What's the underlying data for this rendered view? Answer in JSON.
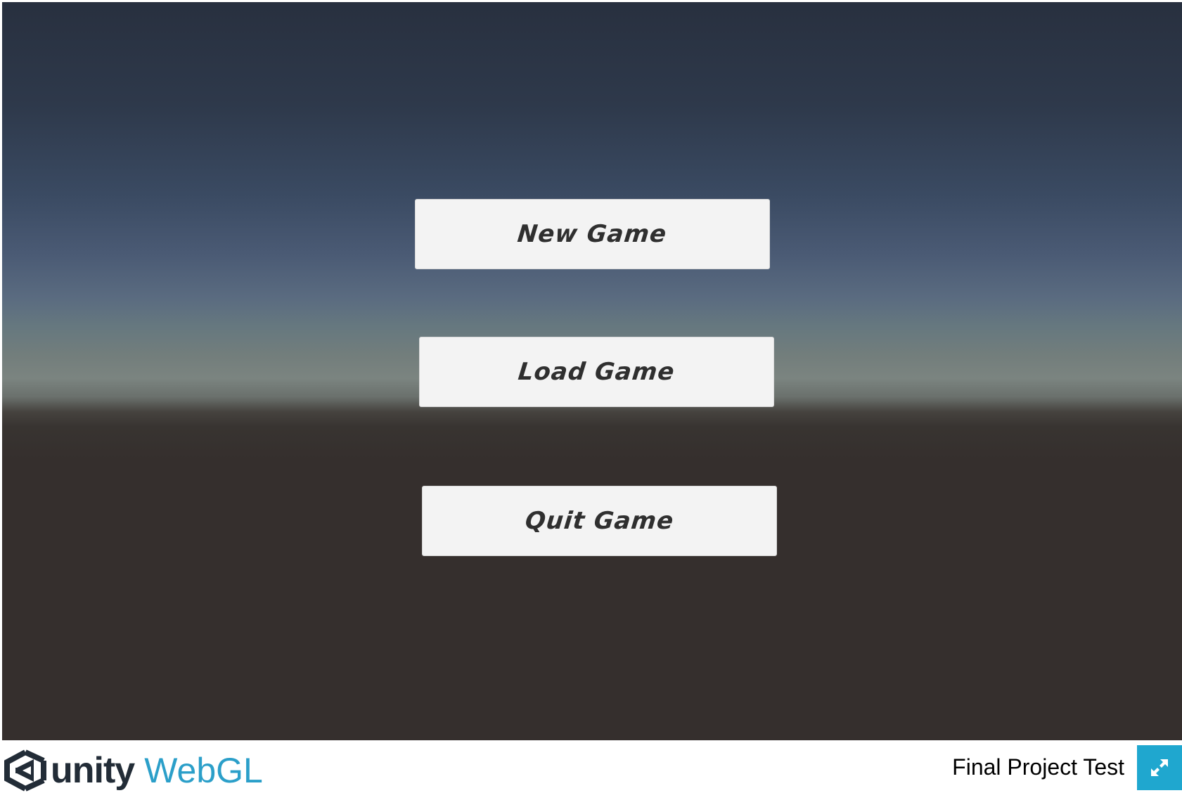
{
  "menu": {
    "new_game": "New Game",
    "load_game": "Load Game",
    "quit_game": "Quit Game"
  },
  "footer": {
    "logo_unity": "unity",
    "logo_webgl": "WebGL",
    "project_title": "Final Project Test",
    "fullscreen_icon": "fullscreen-icon"
  },
  "colors": {
    "sky_top": "#28303f",
    "ground": "#352f2d",
    "button_bg": "#f3f3f3",
    "button_text": "#2f2f2f",
    "webgl_accent": "#2b9fc9",
    "fullscreen_bg": "#1fa7cf"
  }
}
